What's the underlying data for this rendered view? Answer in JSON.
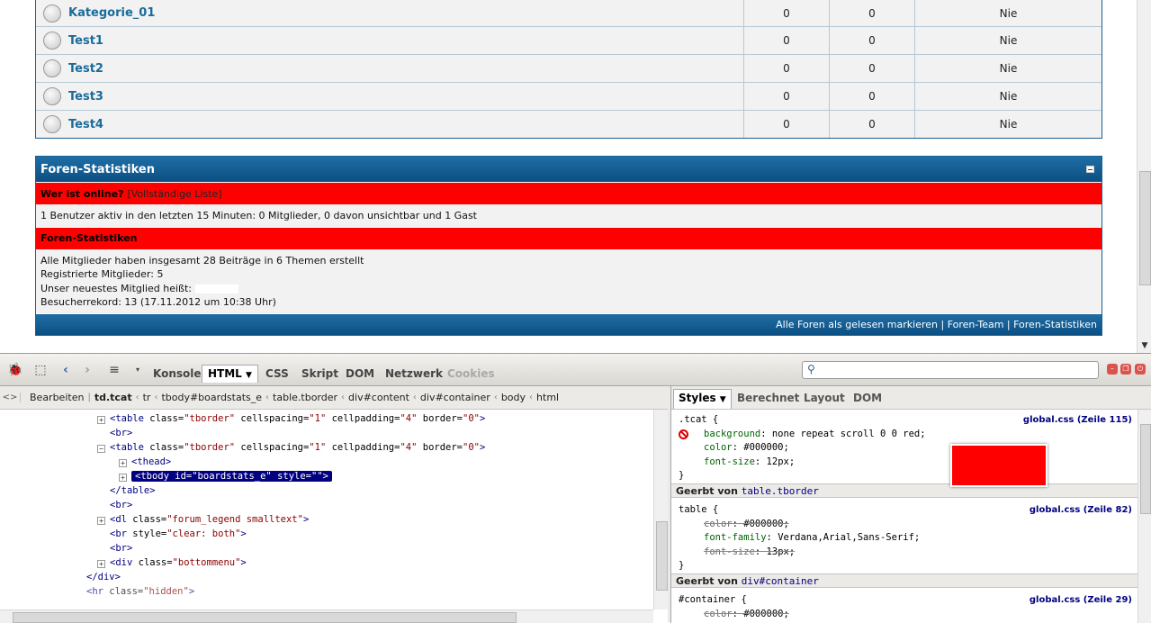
{
  "forums": [
    {
      "name": "Kategorie_01",
      "threads": "0",
      "posts": "0",
      "last": "Nie"
    },
    {
      "name": "Test1",
      "threads": "0",
      "posts": "0",
      "last": "Nie"
    },
    {
      "name": "Test2",
      "threads": "0",
      "posts": "0",
      "last": "Nie"
    },
    {
      "name": "Test3",
      "threads": "0",
      "posts": "0",
      "last": "Nie"
    },
    {
      "name": "Test4",
      "threads": "0",
      "posts": "0",
      "last": "Nie"
    }
  ],
  "stats": {
    "title": "Foren-Statistiken",
    "online_heading": "Wer ist online?",
    "online_link": "[Vollständige Liste]",
    "online_text": "1 Benutzer aktiv in den letzten 15 Minuten: 0 Mitglieder, 0 davon unsichtbar und 1 Gast",
    "stats_heading": "Foren-Statistiken",
    "line1": "Alle Mitglieder haben insgesamt 28 Beiträge in 6 Themen erstellt",
    "line2": "Registrierte Mitglieder: 5",
    "line3": "Unser neuestes Mitglied heißt:",
    "line4": "Besucherrekord: 13 (17.11.2012 um 10:38 Uhr)",
    "footer": "Alle Foren als gelesen markieren | Foren-Team | Foren-Statistiken"
  },
  "firebug": {
    "tabs": {
      "console": "Konsole",
      "html": "HTML",
      "css": "CSS",
      "script": "Skript",
      "dom": "DOM",
      "net": "Netzwerk",
      "cookies": "Cookies"
    },
    "breadcrumb": {
      "edit": "Bearbeiten",
      "items": [
        "td.tcat",
        "tr",
        "tbody#boardstats_e",
        "table.tborder",
        "div#content",
        "div#container",
        "body",
        "html"
      ]
    },
    "tree": {
      "l1_tag": "<table",
      "l1_attr": " class=",
      "l1_val": "\"tborder\"",
      "l1_attr2": " cellspacing=",
      "l1_val2": "\"1\"",
      "l1_attr3": " cellpadding=",
      "l1_val3": "\"4\"",
      "l1_attr4": " border=",
      "l1_val4": "\"0\"",
      "l1_end": ">",
      "br": "<br>",
      "thead": "<thead>",
      "tbody_tag": "<tbody",
      "tbody_attr": " id=",
      "tbody_val": "\"boardstats_e\"",
      "tbody_attr2": " style=",
      "tbody_val2": "\"\"",
      "tbody_end": ">",
      "table_close": "</table>",
      "dl_tag": "<dl",
      "dl_attr": " class=",
      "dl_val": "\"forum_legend smalltext\"",
      "dl_end": ">",
      "brclear_tag": "<br",
      "brclear_attr": " style=",
      "brclear_val": "\"clear: both\"",
      "brclear_end": ">",
      "div_tag": "<div",
      "div_attr": " class=",
      "div_val": "\"bottommenu\"",
      "div_end": ">",
      "div_close": "</div>",
      "hr_tag": "<hr",
      "hr_attr": " class=",
      "hr_val": "\"hidden\"",
      "hr_end": ">"
    },
    "side_tabs": {
      "styles": "Styles",
      "computed": "Berechnet",
      "layout": "Layout",
      "dom": "DOM"
    },
    "rules": {
      "r1_selector": ".tcat {",
      "r1_src": "global.css (Zeile 115)",
      "r1_p1_name": "background",
      "r1_p1_val": ": none repeat scroll 0 0 red;",
      "r1_p2_name": "color",
      "r1_p2_val": ": #000000;",
      "r1_p3_name": "font-size",
      "r1_p3_val": ": 12px;",
      "close": "}",
      "inherit1_label": "Geerbt von",
      "inherit1_ref": "table.tborder",
      "r2_selector": "table {",
      "r2_src": "global.css (Zeile 82)",
      "r2_p1_name": "color",
      "r2_p1_val": ": #000000;",
      "r2_p2_name": "font-family",
      "r2_p2_val": ": Verdana,Arial,Sans-Serif;",
      "r2_p3_name": "font-size",
      "r2_p3_val": ": 13px;",
      "inherit2_label": "Geerbt von",
      "inherit2_ref": "div#container",
      "r3_selector": "#container {",
      "r3_src": "global.css (Zeile 29)",
      "r3_p1_name": "color",
      "r3_p1_val": ": #000000;"
    },
    "swatch_color": "#ff0000"
  }
}
